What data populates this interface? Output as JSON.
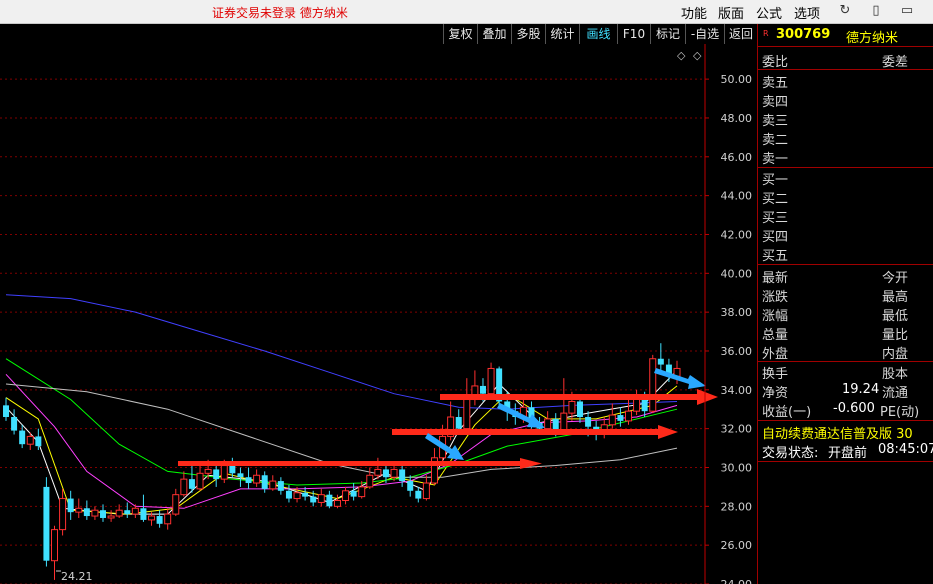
{
  "titlebar": {
    "title": "证券交易未登录  德方纳米",
    "menus": [
      "功能",
      "版面",
      "公式",
      "选项"
    ]
  },
  "toolbar": {
    "buttons": [
      "复权",
      "叠加",
      "多股",
      "统计",
      "画线",
      "F10",
      "标记",
      "-自选",
      "返回"
    ],
    "active": "画线"
  },
  "chart": {
    "type": "candlestick",
    "y_ticks": [
      "50.00",
      "48.00",
      "46.00",
      "44.00",
      "42.00",
      "40.00",
      "38.00",
      "36.00",
      "34.00",
      "32.00",
      "30.00",
      "28.00",
      "26.00",
      "24.00"
    ],
    "ylim": [
      24,
      51.5
    ],
    "low_label": "24.21",
    "colors": {
      "up": "#ff3030",
      "down": "#40e0ff",
      "grid": "#800000",
      "axis": "#c00000"
    },
    "candles": [
      [
        33.2,
        32.6,
        33.6,
        32.4
      ],
      [
        32.6,
        31.9,
        33.0,
        31.7
      ],
      [
        31.9,
        31.2,
        32.2,
        31.0
      ],
      [
        31.2,
        31.6,
        31.8,
        30.9
      ],
      [
        31.6,
        31.1,
        32.0,
        30.9
      ],
      [
        29.0,
        25.2,
        29.5,
        24.9
      ],
      [
        25.2,
        26.8,
        27.0,
        24.21
      ],
      [
        26.8,
        28.4,
        28.9,
        26.5
      ],
      [
        28.4,
        27.7,
        28.8,
        27.3
      ],
      [
        27.7,
        27.9,
        28.4,
        27.4
      ],
      [
        27.9,
        27.5,
        28.3,
        27.3
      ],
      [
        27.5,
        27.8,
        28.0,
        27.3
      ],
      [
        27.8,
        27.4,
        28.1,
        27.2
      ],
      [
        27.4,
        27.5,
        27.8,
        27.2
      ],
      [
        27.5,
        27.8,
        28.1,
        27.4
      ],
      [
        27.8,
        27.6,
        28.2,
        27.4
      ],
      [
        27.6,
        27.9,
        28.1,
        27.4
      ],
      [
        27.9,
        27.3,
        28.6,
        27.2
      ],
      [
        27.3,
        27.5,
        27.7,
        27.0
      ],
      [
        27.5,
        27.1,
        27.8,
        26.9
      ],
      [
        27.1,
        27.6,
        27.9,
        26.8
      ],
      [
        27.6,
        28.6,
        28.9,
        27.5
      ],
      [
        28.6,
        29.4,
        29.8,
        28.5
      ],
      [
        29.4,
        28.9,
        30.2,
        28.7
      ],
      [
        28.9,
        29.7,
        30.1,
        28.8
      ],
      [
        29.7,
        29.9,
        30.4,
        29.4
      ],
      [
        29.9,
        29.4,
        30.1,
        29.0
      ],
      [
        29.4,
        30.1,
        30.4,
        29.2
      ],
      [
        30.1,
        29.7,
        30.5,
        29.5
      ],
      [
        29.7,
        29.5,
        30.0,
        29.0
      ],
      [
        29.5,
        29.2,
        30.0,
        28.9
      ],
      [
        29.2,
        29.6,
        29.9,
        29.0
      ],
      [
        29.6,
        28.9,
        29.8,
        28.7
      ],
      [
        28.9,
        29.3,
        29.6,
        28.8
      ],
      [
        29.3,
        28.8,
        29.5,
        28.6
      ],
      [
        28.8,
        28.4,
        29.1,
        28.2
      ],
      [
        28.4,
        28.7,
        29.0,
        28.2
      ],
      [
        28.7,
        28.5,
        29.0,
        28.3
      ],
      [
        28.5,
        28.2,
        28.8,
        28.0
      ],
      [
        28.2,
        28.6,
        28.9,
        28.0
      ],
      [
        28.6,
        28.0,
        28.8,
        27.9
      ],
      [
        28.0,
        28.3,
        28.6,
        27.9
      ],
      [
        28.3,
        28.8,
        29.0,
        28.1
      ],
      [
        28.8,
        28.5,
        29.2,
        28.3
      ],
      [
        28.5,
        29.0,
        29.3,
        28.4
      ],
      [
        29.0,
        29.6,
        30.0,
        28.9
      ],
      [
        29.6,
        29.9,
        30.5,
        29.4
      ],
      [
        29.9,
        29.5,
        30.3,
        29.2
      ],
      [
        29.5,
        29.9,
        30.2,
        29.3
      ],
      [
        29.9,
        29.3,
        30.1,
        29.0
      ],
      [
        29.3,
        28.8,
        29.6,
        28.5
      ],
      [
        28.8,
        28.4,
        29.0,
        28.2
      ],
      [
        28.4,
        29.2,
        29.6,
        28.3
      ],
      [
        29.2,
        30.5,
        31.0,
        29.1
      ],
      [
        30.5,
        31.6,
        32.2,
        30.3
      ],
      [
        31.6,
        32.6,
        33.4,
        31.4
      ],
      [
        32.6,
        32.0,
        33.0,
        31.7
      ],
      [
        32.0,
        33.5,
        34.6,
        31.9
      ],
      [
        33.5,
        34.2,
        35.0,
        33.2
      ],
      [
        34.2,
        33.8,
        34.6,
        33.4
      ],
      [
        33.8,
        35.1,
        35.4,
        33.6
      ],
      [
        35.1,
        33.4,
        35.2,
        33.1
      ],
      [
        33.4,
        32.9,
        33.9,
        32.4
      ],
      [
        32.9,
        32.6,
        33.3,
        32.2
      ],
      [
        32.6,
        33.1,
        33.5,
        32.3
      ],
      [
        33.1,
        32.3,
        33.4,
        32.0
      ],
      [
        32.3,
        32.0,
        32.6,
        31.7
      ],
      [
        32.0,
        32.5,
        32.9,
        31.8
      ],
      [
        32.5,
        31.9,
        32.8,
        31.6
      ],
      [
        31.9,
        32.8,
        34.6,
        31.7
      ],
      [
        32.8,
        33.4,
        33.9,
        32.4
      ],
      [
        33.4,
        32.6,
        33.6,
        32.3
      ],
      [
        32.6,
        32.1,
        32.9,
        31.6
      ],
      [
        32.1,
        31.7,
        32.4,
        31.4
      ],
      [
        31.7,
        32.2,
        32.6,
        31.5
      ],
      [
        32.2,
        32.7,
        33.3,
        32.0
      ],
      [
        32.7,
        32.4,
        33.1,
        32.1
      ],
      [
        32.4,
        32.9,
        33.5,
        32.2
      ],
      [
        32.9,
        33.6,
        34.0,
        32.7
      ],
      [
        33.6,
        32.9,
        33.9,
        32.6
      ],
      [
        32.9,
        35.6,
        35.8,
        32.8
      ],
      [
        35.6,
        35.3,
        36.4,
        34.9
      ],
      [
        35.3,
        34.7,
        35.6,
        34.4
      ],
      [
        34.7,
        35.1,
        35.5,
        34.3
      ]
    ],
    "ma_colors": [
      "#ffffff",
      "#ffff00",
      "#ff40ff",
      "#00ff00",
      "#c0c0c0",
      "#4040ff"
    ],
    "ma_lines": [
      [
        [
          0,
          33.1
        ],
        [
          4,
          31.3
        ],
        [
          7,
          27.9
        ],
        [
          14,
          27.6
        ],
        [
          20,
          27.6
        ],
        [
          25,
          29.6
        ],
        [
          32,
          29.3
        ],
        [
          40,
          28.2
        ],
        [
          47,
          29.7
        ],
        [
          52,
          28.8
        ],
        [
          56,
          31.9
        ],
        [
          61,
          34.3
        ],
        [
          66,
          32.3
        ],
        [
          72,
          32.8
        ],
        [
          79,
          33.3
        ],
        [
          83,
          35.0
        ]
      ],
      [
        [
          0,
          33.6
        ],
        [
          4,
          32.5
        ],
        [
          8,
          27.8
        ],
        [
          15,
          27.6
        ],
        [
          21,
          27.9
        ],
        [
          27,
          29.7
        ],
        [
          33,
          29.1
        ],
        [
          41,
          28.4
        ],
        [
          48,
          29.5
        ],
        [
          53,
          29.1
        ],
        [
          58,
          32.2
        ],
        [
          62,
          33.8
        ],
        [
          67,
          32.5
        ],
        [
          73,
          32.5
        ],
        [
          80,
          33.2
        ],
        [
          83,
          34.2
        ]
      ],
      [
        [
          0,
          34.8
        ],
        [
          6,
          32.1
        ],
        [
          10,
          29.8
        ],
        [
          16,
          28.0
        ],
        [
          22,
          27.9
        ],
        [
          29,
          28.9
        ],
        [
          36,
          28.9
        ],
        [
          44,
          29.0
        ],
        [
          50,
          29.3
        ],
        [
          55,
          30.2
        ],
        [
          60,
          31.7
        ],
        [
          66,
          32.3
        ],
        [
          72,
          32.4
        ],
        [
          78,
          32.6
        ],
        [
          83,
          33.2
        ]
      ],
      [
        [
          0,
          35.6
        ],
        [
          8,
          33.5
        ],
        [
          14,
          31.2
        ],
        [
          20,
          29.8
        ],
        [
          28,
          29.4
        ],
        [
          36,
          29.1
        ],
        [
          44,
          29.2
        ],
        [
          50,
          29.5
        ],
        [
          56,
          30.2
        ],
        [
          62,
          31.1
        ],
        [
          70,
          31.7
        ],
        [
          77,
          32.4
        ],
        [
          83,
          33.0
        ]
      ],
      [
        [
          0,
          34.3
        ],
        [
          10,
          33.9
        ],
        [
          20,
          33.0
        ],
        [
          30,
          31.6
        ],
        [
          40,
          30.2
        ],
        [
          48,
          29.5
        ],
        [
          54,
          29.5
        ],
        [
          60,
          29.9
        ],
        [
          68,
          30.1
        ],
        [
          76,
          30.4
        ],
        [
          83,
          31.0
        ]
      ],
      [
        [
          0,
          38.9
        ],
        [
          8,
          38.7
        ],
        [
          16,
          38.0
        ],
        [
          24,
          37.0
        ],
        [
          32,
          36.0
        ],
        [
          40,
          34.9
        ],
        [
          48,
          33.8
        ],
        [
          56,
          33.1
        ],
        [
          62,
          33.0
        ],
        [
          70,
          33.2
        ],
        [
          77,
          33.3
        ],
        [
          83,
          33.4
        ]
      ]
    ]
  },
  "side": {
    "code_prefix": "R",
    "code": "300769",
    "name": "德方纳米",
    "wb_left": "委比",
    "wb_right": "委差",
    "asks": [
      "卖五",
      "卖四",
      "卖三",
      "卖二",
      "卖一"
    ],
    "bids": [
      "买一",
      "买二",
      "买三",
      "买四",
      "买五"
    ],
    "stats": [
      {
        "l": "最新",
        "r": "今开"
      },
      {
        "l": "涨跌",
        "r": "最高"
      },
      {
        "l": "涨幅",
        "r": "最低"
      },
      {
        "l": "总量",
        "r": "量比"
      },
      {
        "l": "外盘",
        "r": "内盘"
      }
    ],
    "fin": [
      {
        "l": "换手",
        "v": "",
        "r": "股本"
      },
      {
        "l": "净资",
        "v": "19.24",
        "r": "流通"
      },
      {
        "l": "收益(一)",
        "v": "-0.600",
        "r": "PE(动)"
      }
    ],
    "notice": "自动续费通达信普及版  30",
    "status_label": "交易状态:",
    "status_value": "开盘前",
    "status_time": "08:45:07"
  }
}
